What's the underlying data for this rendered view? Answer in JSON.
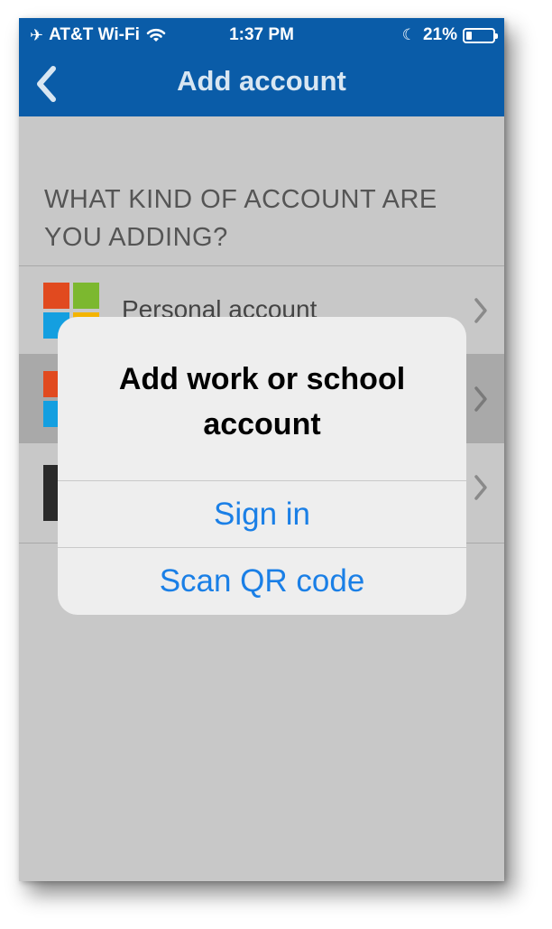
{
  "status_bar": {
    "carrier": "AT&T Wi-Fi",
    "time": "1:37 PM",
    "battery": "21%",
    "battery_level": 0.21
  },
  "nav": {
    "title": "Add account",
    "back_icon": "chevron-left-icon"
  },
  "list": {
    "section_header": "WHAT KIND OF ACCOUNT ARE YOU ADDING?",
    "items": [
      {
        "label": "Personal account",
        "icon": "microsoft-logo-icon"
      },
      {
        "label": "",
        "icon": "microsoft-logo-icon"
      },
      {
        "label": "",
        "icon": "account-logo-icon"
      }
    ]
  },
  "alert": {
    "title": "Add work or school account",
    "actions": [
      {
        "label": "Sign in"
      },
      {
        "label": "Scan QR code"
      }
    ]
  },
  "colors": {
    "nav_bar": "#0a5ca8",
    "action_blue": "#1a7fe6",
    "ms_red": "#e14a1f",
    "ms_green": "#7cb82f",
    "ms_blue": "#149fe0",
    "ms_yellow": "#f4b400"
  }
}
